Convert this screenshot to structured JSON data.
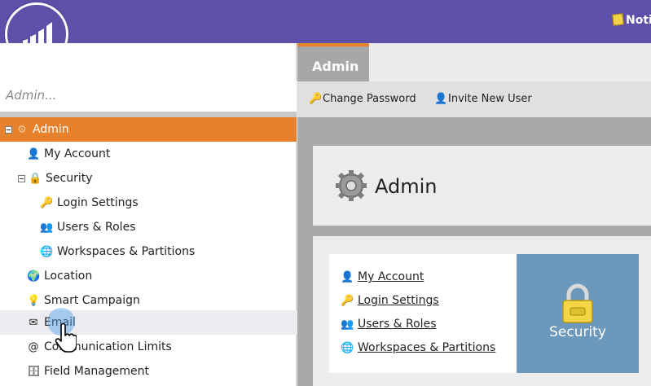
{
  "header": {
    "notification_label": "Noti",
    "brand_color": "#5e4fa8"
  },
  "sidebar": {
    "search_placeholder": "Admin...",
    "items": [
      {
        "label": "Admin",
        "icon": "gear-icon"
      },
      {
        "label": "My Account",
        "icon": "user-icon"
      },
      {
        "label": "Security",
        "icon": "lock-icon"
      },
      {
        "label": "Login Settings",
        "icon": "key-icon"
      },
      {
        "label": "Users & Roles",
        "icon": "users-icon"
      },
      {
        "label": "Workspaces & Partitions",
        "icon": "globe-icon"
      },
      {
        "label": "Location",
        "icon": "location-globe-icon"
      },
      {
        "label": "Smart Campaign",
        "icon": "lightbulb-icon"
      },
      {
        "label": "Email",
        "icon": "email-icon"
      },
      {
        "label": "Communication Limits",
        "icon": "at-sign-icon"
      },
      {
        "label": "Field Management",
        "icon": "field-management-icon"
      }
    ]
  },
  "main": {
    "tab_label": "Admin",
    "toolbar": {
      "change_password": "Change Password",
      "invite_new_user": "Invite New User"
    },
    "page_title": "Admin",
    "card_links": [
      "My Account",
      "Login Settings",
      "Users & Roles",
      "Workspaces & Partitions"
    ],
    "security_tile_label": "Security"
  },
  "colors": {
    "accent_orange": "#e8812c",
    "tile_blue": "#6b98bb"
  }
}
